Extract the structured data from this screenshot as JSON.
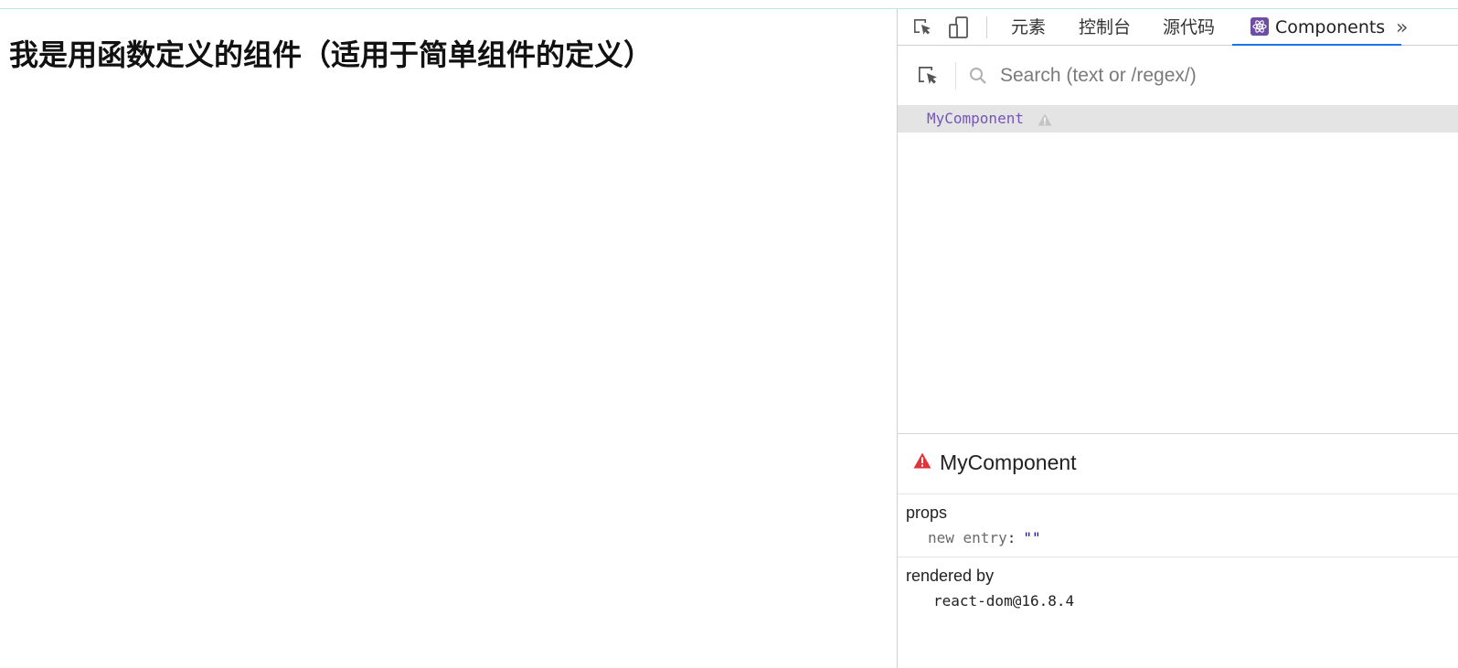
{
  "page": {
    "heading": "我是用函数定义的组件（适用于简单组件的定义）"
  },
  "devtools": {
    "tabs": [
      {
        "label": "元素",
        "active": false
      },
      {
        "label": "控制台",
        "active": false
      },
      {
        "label": "源代码",
        "active": false
      },
      {
        "label": "Components",
        "active": true
      }
    ],
    "icons": {
      "inspect": "element-picker-icon",
      "device": "device-toolbar-icon",
      "more": "more-tabs-icon",
      "search": "search-icon",
      "warning": "warning-icon",
      "error": "error-icon"
    },
    "search": {
      "placeholder": "Search (text or /regex/)",
      "value": ""
    },
    "tree": {
      "selected": "MyComponent"
    },
    "detail": {
      "component_name": "MyComponent",
      "props_label": "props",
      "props": [
        {
          "key": "new entry",
          "value": "\"\""
        }
      ],
      "rendered_by_label": "rendered by",
      "rendered_by": "react-dom@16.8.4"
    },
    "colors": {
      "accent": "#1a73e8",
      "component_name": "#7655b8",
      "error": "#e0343b",
      "string_value": "#1a1aa6",
      "selected_row": "#e4e4e4"
    }
  }
}
